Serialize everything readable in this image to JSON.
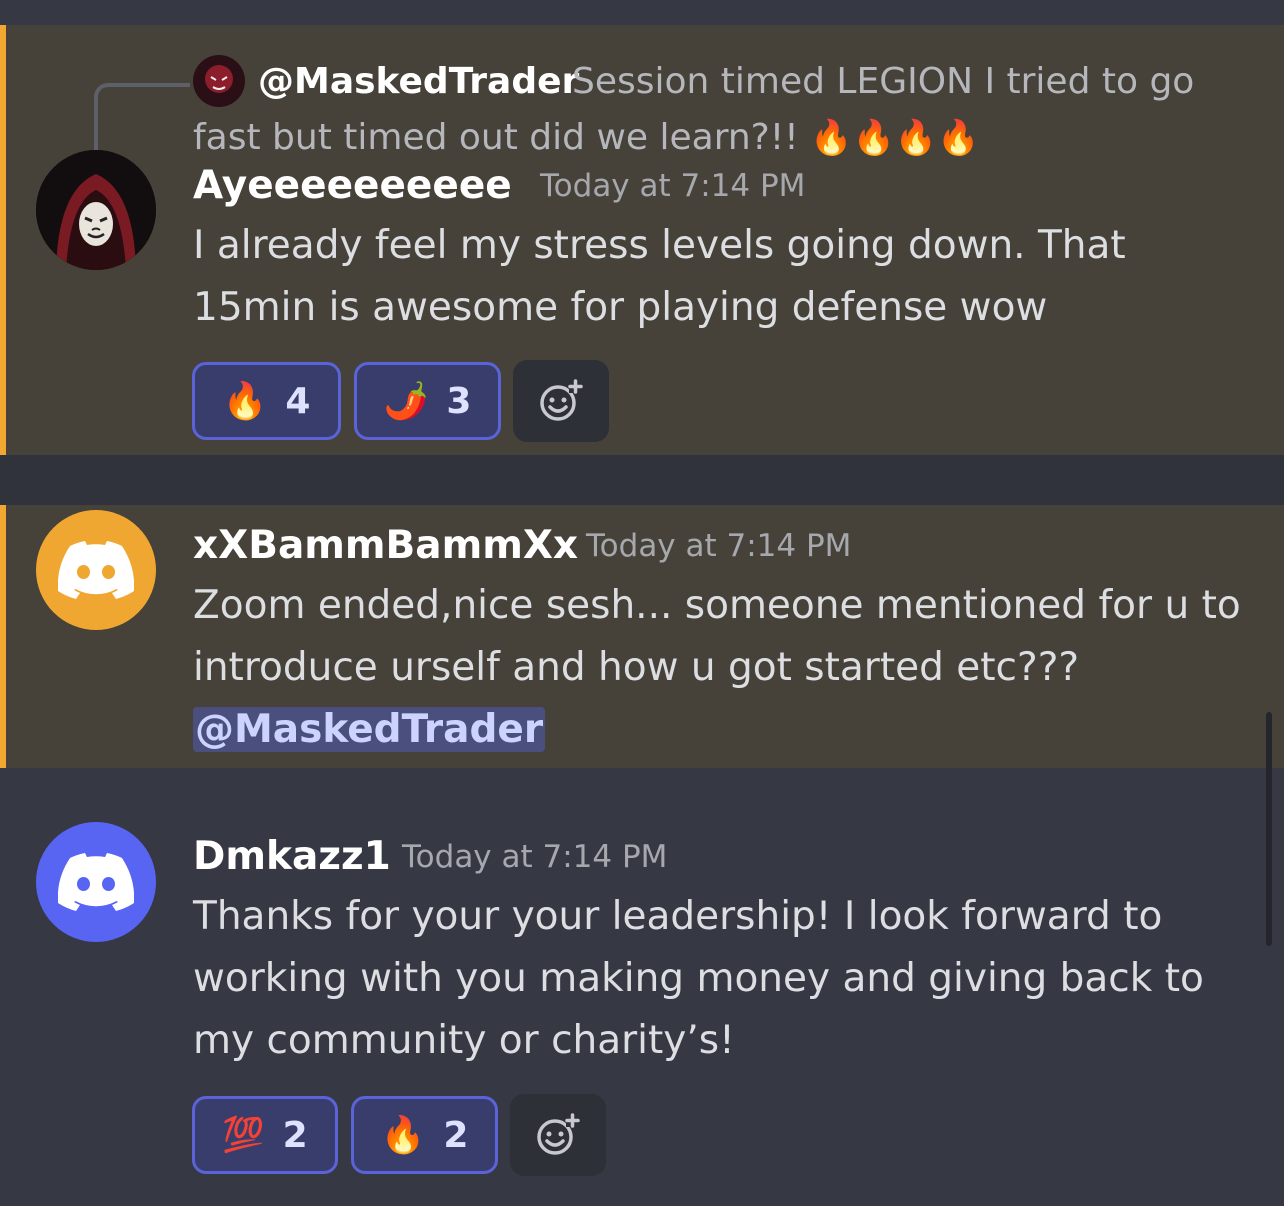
{
  "messages": [
    {
      "reply": {
        "user": "@MaskedTrader",
        "text_line1": "Session timed  LEGION I tried to go",
        "text_line2": "fast but timed out did we learn?!!",
        "emoji": "🔥🔥🔥🔥"
      },
      "author": "Ayeeeeeeeeee",
      "timestamp": "Today at 7:14 PM",
      "lines": [
        "I already feel my stress levels going down. That",
        "15min is awesome for playing defense wow"
      ],
      "reactions": [
        {
          "emoji": "🔥",
          "count": "4"
        },
        {
          "emoji": "🌶️",
          "count": "3"
        }
      ]
    },
    {
      "author": "xXBammBammXx",
      "timestamp": "Today at 7:14 PM",
      "lines": [
        "Zoom ended,nice sesh... someone mentioned for u to",
        "introduce urself and how u got started etc???"
      ],
      "mention": "@MaskedTrader"
    },
    {
      "author": "Dmkazz1",
      "timestamp": "Today at 7:14 PM",
      "lines": [
        "Thanks for your your leadership!  I look forward to",
        "working with you making money and giving back to",
        "my community or charity’s!"
      ],
      "reactions": [
        {
          "emoji": "💯",
          "count": "2"
        },
        {
          "emoji": "🔥",
          "count": "2"
        }
      ]
    }
  ],
  "colors": {
    "background": "#363944",
    "mention_highlight": "#464239",
    "mention_bar": "#f0a833",
    "reaction_bg": "#393d6c",
    "reaction_border": "#5a63d8",
    "avatar_orange": "#f0a732",
    "avatar_blurple": "#5865f2"
  }
}
